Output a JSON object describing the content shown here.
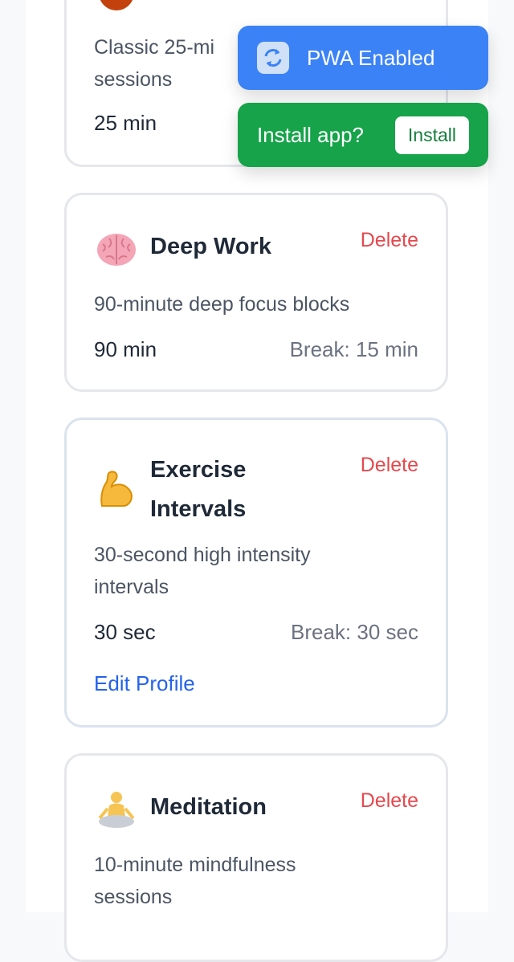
{
  "profiles": [
    {
      "description": "Classic 25-minute sessions",
      "description_visible": "Classic 25-mi",
      "description_line2": "sessions",
      "duration": "25 min"
    },
    {
      "title": "Deep Work",
      "delete_label": "Delete",
      "description": "90-minute deep focus blocks",
      "duration": "90 min",
      "break": "Break: 15 min"
    },
    {
      "title_line1": "Exercise",
      "title_line2": "Intervals",
      "delete_label": "Delete",
      "description_line1": "30-second high intensity",
      "description_line2": "intervals",
      "duration": "30 sec",
      "break": "Break: 30 sec",
      "edit_label": "Edit Profile"
    },
    {
      "title": "Meditation",
      "delete_label": "Delete",
      "description_line1": "10-minute mindfulness",
      "description_line2": "sessions"
    }
  ],
  "toasts": {
    "pwa_text": "PWA Enabled",
    "install_text": "Install app?",
    "install_button": "Install"
  },
  "icons": {
    "card0": "tomato-icon",
    "card1": "brain-icon",
    "card2": "flexed-biceps-icon",
    "card3": "meditation-icon",
    "pwa": "refresh-icon"
  },
  "colors": {
    "delete": "#e5484d",
    "link": "#2563eb",
    "pwa_toast": "#3b82f6",
    "install_toast": "#16a34a"
  }
}
